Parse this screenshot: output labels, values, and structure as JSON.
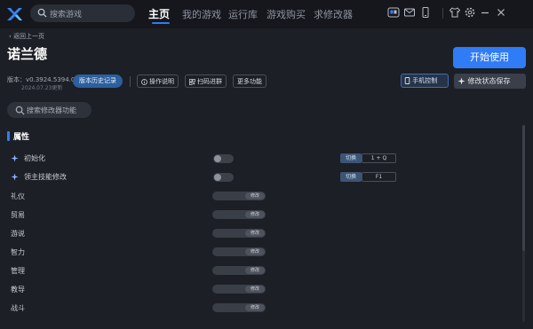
{
  "header": {
    "search_placeholder": "搜索游戏",
    "nav": [
      {
        "label": "主页",
        "active": true
      },
      {
        "label": "我的游戏",
        "active": false
      },
      {
        "label": "运行库",
        "active": false
      },
      {
        "label": "游戏购买",
        "active": false
      },
      {
        "label": "求修改器",
        "active": false
      }
    ],
    "icons": [
      "gamepad-icon",
      "mail-icon",
      "phone-icon",
      "shirt-icon",
      "gear-icon",
      "minimize-icon",
      "close-icon"
    ]
  },
  "back_label": "返回上一页",
  "title": "诺兰德",
  "start_label": "开始使用",
  "version": "版本：v0.3924.5394.0",
  "date": "2024.07.23更新",
  "history_label": "版本历史记录",
  "tools": [
    "操作说明",
    "扫码进群",
    "更多功能"
  ],
  "phone_control_label": "手机控制",
  "save_state_label": "修改状态保存",
  "feature_search_placeholder": "搜索修改器功能",
  "section_title": "属性",
  "toggle_rows": [
    {
      "label": "初始化",
      "hotkey_tag": "切换",
      "hotkey": "1 + Q"
    },
    {
      "label": "领主技能修改",
      "hotkey_tag": "切换",
      "hotkey": "F1"
    }
  ],
  "slider_button_label": "修改",
  "slider_rows": [
    "礼仪",
    "贸易",
    "游说",
    "智力",
    "管理",
    "教导",
    "战斗"
  ],
  "colors": {
    "accent": "#2f7cf6",
    "background": "#1c1f26"
  }
}
